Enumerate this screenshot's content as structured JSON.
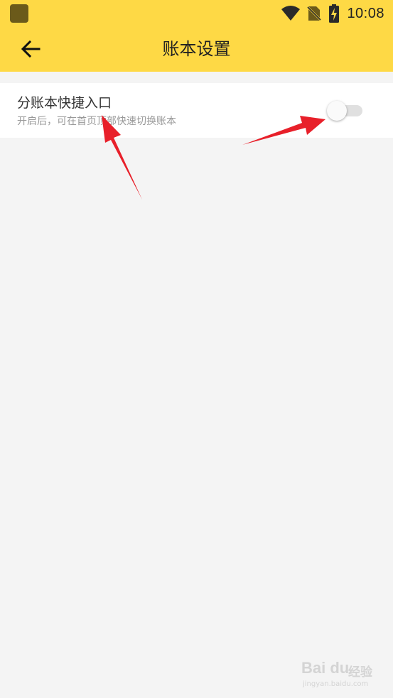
{
  "status_bar": {
    "time": "10:08",
    "icons": [
      "app-notification-icon",
      "wifi-icon",
      "no-sim-icon",
      "battery-charging-icon"
    ]
  },
  "header": {
    "title": "账本设置",
    "back_icon": "arrow-left-icon"
  },
  "settings": {
    "items": [
      {
        "title": "分账本快捷入口",
        "subtitle": "开启后，可在首页顶部快速切换账本",
        "enabled": false
      }
    ]
  },
  "colors": {
    "header_background": "#fed945",
    "page_background": "#f4f4f4",
    "annotation_arrow": "#e8202a"
  },
  "watermark": {
    "logo": "Bai du",
    "text": "经验",
    "url": "jingyan.baidu.com"
  }
}
